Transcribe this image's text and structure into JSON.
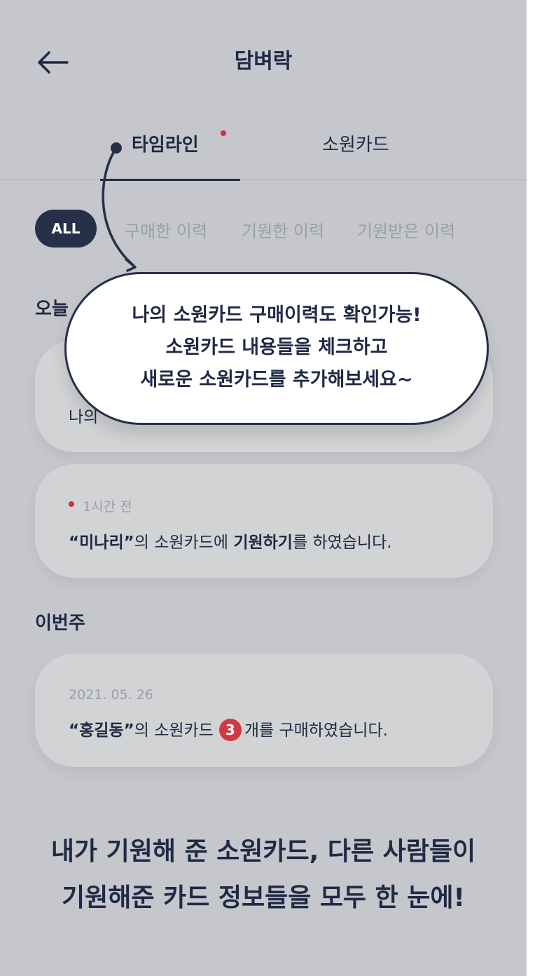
{
  "header": {
    "title": "담벼락",
    "back_icon": "arrow-left-icon"
  },
  "tabs": [
    {
      "label": "타임라인",
      "active": true,
      "has_new": true
    },
    {
      "label": "소원카드",
      "active": false
    }
  ],
  "filters": [
    {
      "label": "ALL",
      "selected": true
    },
    {
      "label": "구매한 이력"
    },
    {
      "label": "기원한 이력"
    },
    {
      "label": "기원받은 이력"
    }
  ],
  "sections": {
    "today": "오늘",
    "this_week": "이번주"
  },
  "cards": {
    "c1": {
      "text_visible": "나의"
    },
    "c2": {
      "time": "1시간 전",
      "q_open": "“",
      "name": "미나리",
      "q_close": "”",
      "mid": "의 소원카드에 ",
      "action": "기원하기",
      "tail": "를 하였습니다."
    },
    "c3": {
      "date": "2021. 05. 26",
      "q_open": "“",
      "name": "홍길동",
      "q_close": "”",
      "mid": "의 소원카드",
      "count": "3",
      "tail": "개를 구매하였습니다."
    }
  },
  "callout": {
    "lines": [
      "나의 소원카드 구매이력도 확인가능!",
      "소원카드 내용들을 체크하고",
      "새로운 소원카드를 추가해보세요~"
    ]
  },
  "footer": {
    "lines": [
      "내가 기원해 준 소원카드, 다른 사람들이",
      "기원해준 카드 정보들을 모두 한 눈에!"
    ]
  },
  "colors": {
    "navy": "#1f2a44",
    "accent_red": "#d0303a",
    "muted": "#9b9fa8",
    "overlay_bg": "#c5c7cd"
  }
}
